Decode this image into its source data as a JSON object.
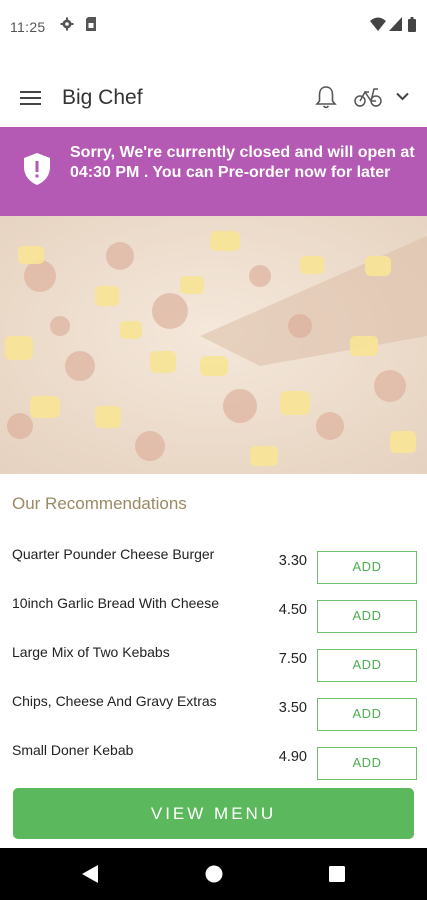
{
  "status_bar": {
    "time": "11:25",
    "icons": [
      "gear-icon",
      "sim-card-icon",
      "wifi-icon",
      "signal-icon",
      "battery-icon"
    ]
  },
  "app_bar": {
    "title": "Big Chef",
    "icons": [
      "menu-icon",
      "bell-icon",
      "bicycle-icon",
      "chevron-down-icon"
    ]
  },
  "banner": {
    "message": "Sorry, We're currently closed and will open at 04:30 PM . You can Pre-order now for later",
    "color": "#b45ab4",
    "icon": "shield-alert-icon"
  },
  "hero": {
    "image": "pizza-photo"
  },
  "recommendations": {
    "title": "Our Recommendations",
    "add_label": "ADD",
    "items": [
      {
        "name": "Quarter Pounder Cheese Burger",
        "price": "3.30"
      },
      {
        "name": "10inch Garlic Bread With Cheese",
        "price": "4.50"
      },
      {
        "name": "Large Mix of Two Kebabs",
        "price": "7.50"
      },
      {
        "name": "Chips, Cheese And Gravy Extras",
        "price": "3.50"
      },
      {
        "name": "Small Doner Kebab",
        "price": "4.90"
      }
    ]
  },
  "view_menu": {
    "label": "VIEW MENU",
    "color": "#5cb85c"
  },
  "nav_bar": {
    "icons": [
      "back-icon",
      "home-icon",
      "recents-icon"
    ]
  }
}
